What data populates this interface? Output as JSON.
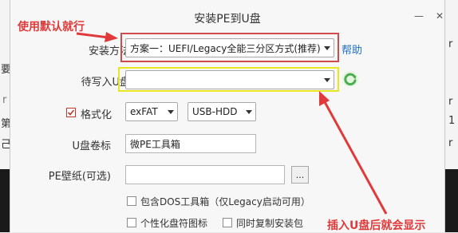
{
  "window": {
    "title": "安装PE到U盘"
  },
  "titlebar": {
    "minimize_symbol": "—",
    "close_symbol": "✕"
  },
  "form": {
    "install_method_label": "安装方法",
    "install_method_value": "方案一：UEFI/Legacy全能三分区方式(推荐)",
    "help_link": "帮助",
    "target_disk_label": "待写入U盘",
    "target_disk_value": "",
    "format_label": "格式化",
    "format_checked": true,
    "filesystem_value": "exFAT",
    "boot_mode_value": "USB-HDD",
    "volume_label_label": "U盘卷标",
    "volume_label_value": "微PE工具箱",
    "wallpaper_label": "PE壁纸(可选)",
    "wallpaper_value": "",
    "browse_label": "...",
    "option_dos": "包含DOS工具箱（仅Legacy启动可用）",
    "option_icon": "个性化盘符图标",
    "option_copy": "同时复制安装包"
  },
  "annotations": {
    "default_hint": "使用默认就行",
    "insert_hint": "插入U盘后就会显示"
  },
  "background": {
    "left_chars": [
      "要",
      "r",
      "第",
      "己"
    ],
    "right_chars": [
      "r",
      "r",
      "1",
      "r"
    ]
  },
  "colors": {
    "highlight_red": "#d04b4b",
    "highlight_yellow": "#e8e620",
    "annotation_red": "#e03a3a",
    "link_blue": "#1f6fbf",
    "refresh_green": "#4caf50"
  }
}
